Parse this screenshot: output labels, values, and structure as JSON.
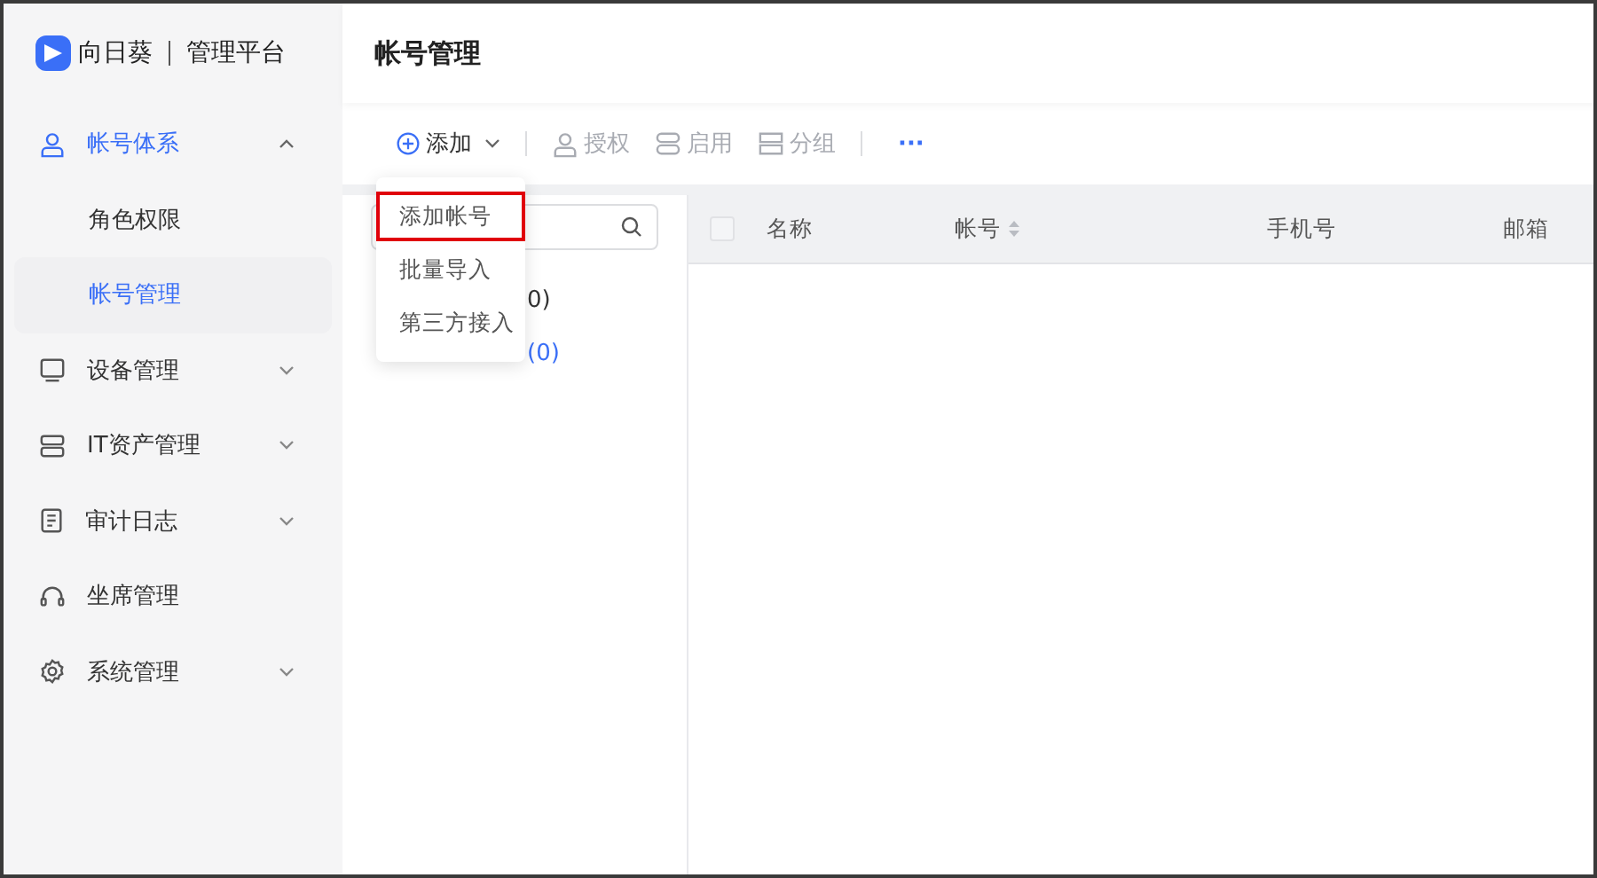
{
  "brand": {
    "name": "向日葵",
    "subtitle": "管理平台"
  },
  "sidebar": {
    "items": [
      {
        "label": "帐号体系",
        "expanded": true,
        "children": [
          {
            "label": "角色权限",
            "selected": false
          },
          {
            "label": "帐号管理",
            "selected": true
          }
        ]
      },
      {
        "label": "设备管理",
        "expanded": false
      },
      {
        "label": "IT资产管理",
        "expanded": false
      },
      {
        "label": "审计日志",
        "expanded": false
      },
      {
        "label": "坐席管理"
      },
      {
        "label": "系统管理",
        "expanded": false
      }
    ]
  },
  "page": {
    "title": "帐号管理"
  },
  "toolbar": [
    {
      "label": "添加",
      "kind": "action",
      "disabled": false,
      "dropdown": true
    },
    {
      "label": "授权",
      "kind": "action",
      "disabled": true
    },
    {
      "label": "启用",
      "kind": "action",
      "disabled": true
    },
    {
      "label": "分组",
      "kind": "action",
      "disabled": true
    },
    {
      "label": "···",
      "kind": "more",
      "disabled": false
    }
  ],
  "dropdown": {
    "items": [
      {
        "label": "添加帐号",
        "highlighted": true
      },
      {
        "label": "批量导入",
        "highlighted": false
      },
      {
        "label": "第三方接入",
        "highlighted": false
      }
    ]
  },
  "tree": {
    "items": [
      {
        "label": "0)",
        "selected": false
      },
      {
        "label": "(0)",
        "selected": true
      }
    ]
  },
  "table": {
    "select_all": {
      "checked": false
    },
    "columns": [
      {
        "label": "名称",
        "sortable": false
      },
      {
        "label": "帐号",
        "sortable": true
      },
      {
        "label": "手机号",
        "sortable": false
      },
      {
        "label": "邮箱",
        "sortable": false
      }
    ]
  }
}
